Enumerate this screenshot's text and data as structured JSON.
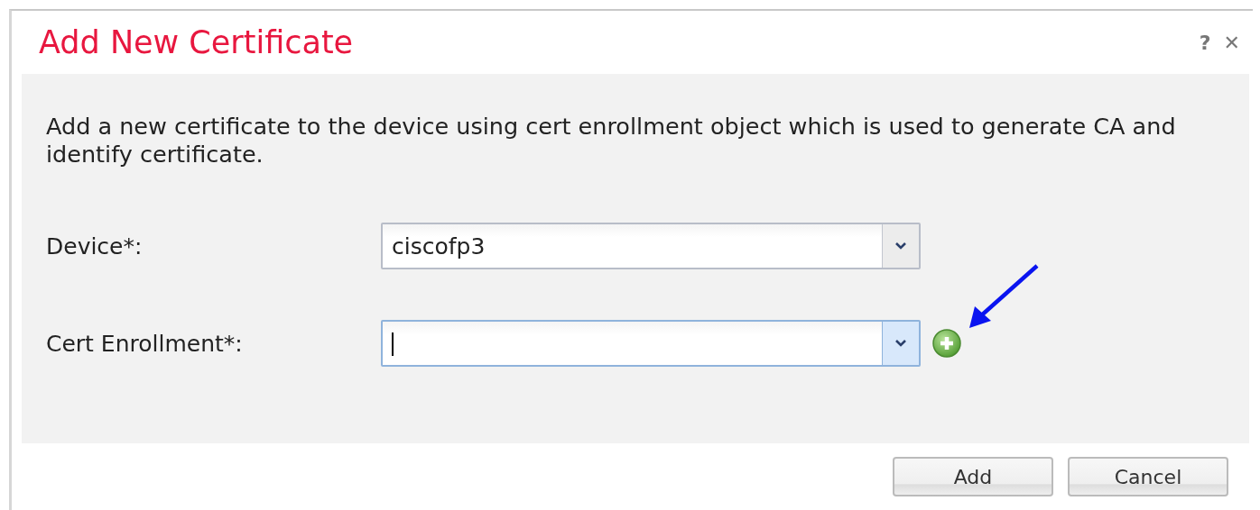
{
  "dialog": {
    "title": "Add New Certificate",
    "help": "?",
    "close": "✕"
  },
  "description": "Add a new certificate to the device using cert enrollment object which is used to generate CA and identify certificate.",
  "fields": [
    {
      "label": "Device*:",
      "value": "ciscofp3",
      "focused": false,
      "add_button": false
    },
    {
      "label": "Cert Enrollment*:",
      "focused": true,
      "add_button": true
    }
  ],
  "buttons": [
    "Add",
    "Cancel"
  ]
}
